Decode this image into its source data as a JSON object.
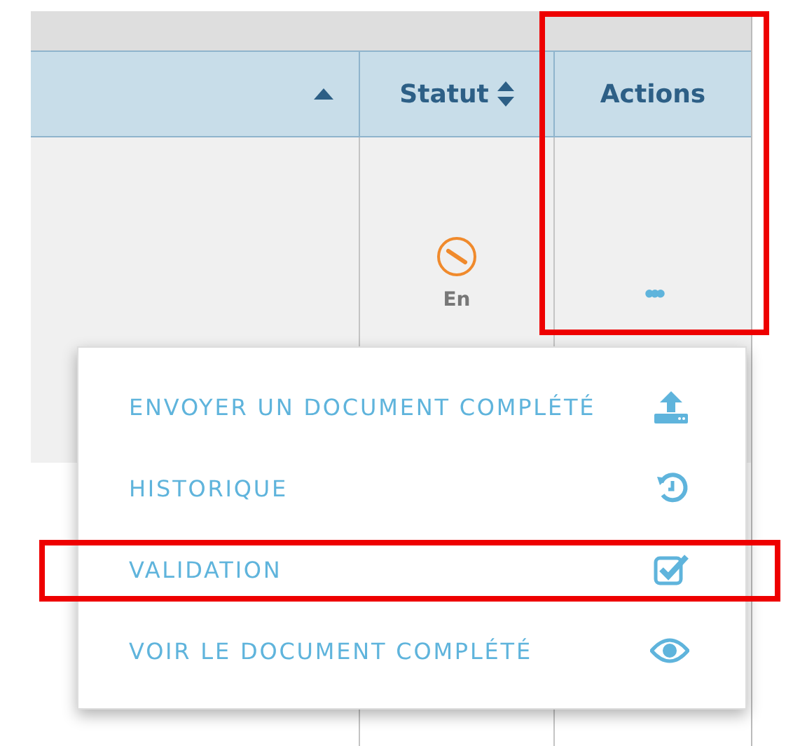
{
  "table": {
    "columns": [
      {
        "highlighted": false
      },
      {
        "label": "Statut",
        "highlighted": false
      },
      {
        "label": "Actions",
        "highlighted": true
      }
    ],
    "rows": [
      {
        "status": "En",
        "actions": "•••"
      }
    ]
  },
  "menu": {
    "items": [
      {
        "label": "ENVOYER UN DOCUMENT COMPLÉTÉ",
        "highlighted": false
      },
      {
        "label": "HISTORIQUE",
        "highlighted": false
      },
      {
        "label": "VALIDATION",
        "highlighted": true
      },
      {
        "label": "VOIR LE DOCUMENT COMPLÉTÉ",
        "highlighted": false
      }
    ]
  }
}
